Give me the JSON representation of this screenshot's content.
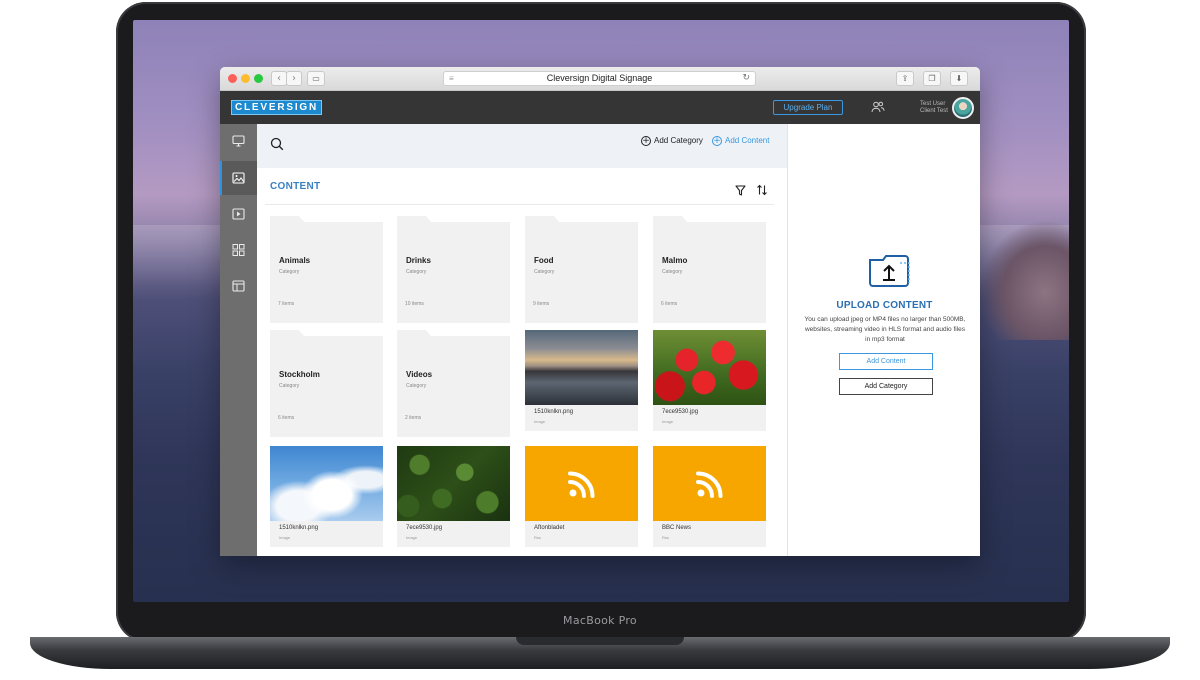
{
  "device": {
    "label": "MacBook Pro"
  },
  "browser": {
    "title": "Cleversign Digital Signage",
    "reload_glyph": "↻",
    "back_glyph": "‹",
    "forward_glyph": "›"
  },
  "app": {
    "logo_text": "CLEVERSIGN",
    "upgrade_label": "Upgrade Plan",
    "user": {
      "name": "Test User",
      "role": "Client Test"
    }
  },
  "sidebar": {
    "items": [
      {
        "icon": "monitor-icon",
        "active": false
      },
      {
        "icon": "image-icon",
        "active": true
      },
      {
        "icon": "play-icon",
        "active": false
      },
      {
        "icon": "grid-icon",
        "active": false
      },
      {
        "icon": "layout-icon",
        "active": false
      }
    ]
  },
  "toolbar": {
    "add_category_label": "Add Category",
    "add_content_label": "Add Content"
  },
  "content": {
    "title": "CONTENT",
    "folders": [
      {
        "name": "Animals",
        "type": "Category",
        "count": "7 items"
      },
      {
        "name": "Drinks",
        "type": "Category",
        "count": "10 items"
      },
      {
        "name": "Food",
        "type": "Category",
        "count": "9 items"
      },
      {
        "name": "Malmo",
        "type": "Category",
        "count": "6 items"
      },
      {
        "name": "Stockholm",
        "type": "Category",
        "count": "6 items"
      },
      {
        "name": "Videos",
        "type": "Category",
        "count": "2 items"
      }
    ],
    "media": [
      {
        "name": "1510knlkn.png",
        "type": "Image",
        "thumb": "sunset"
      },
      {
        "name": "7ece9530.jpg",
        "type": "Image",
        "thumb": "tulips"
      },
      {
        "name": "1510knlkn.png",
        "type": "Image",
        "thumb": "sky"
      },
      {
        "name": "7ece9530.jpg",
        "type": "Image",
        "thumb": "forest"
      },
      {
        "name": "Aftonbladet",
        "type": "Rss",
        "thumb": "rss"
      },
      {
        "name": "BBC News",
        "type": "Rss",
        "thumb": "rss"
      }
    ]
  },
  "upload_panel": {
    "title": "UPLOAD CONTENT",
    "description": "You can upload jpeg or MP4 files no larger than 500MB, websites, streaming video in HLS format and audio files in mp3 format",
    "add_content_label": "Add Content",
    "add_category_label": "Add Category"
  },
  "colors": {
    "accent": "#3a97e0",
    "header": "#353535",
    "sidebar": "#6e6e6e",
    "rss": "#f7a600"
  }
}
